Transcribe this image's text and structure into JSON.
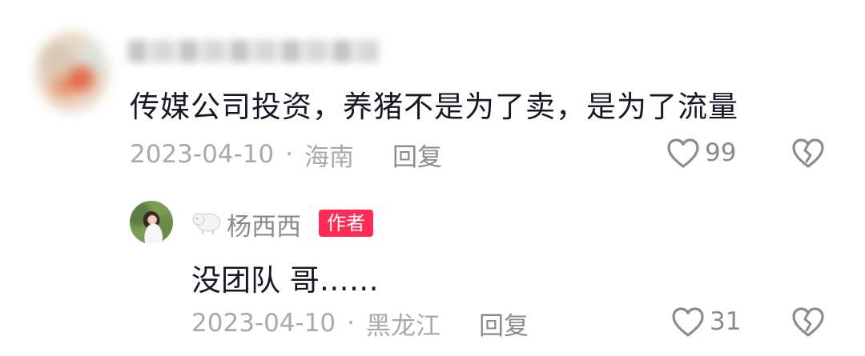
{
  "comment": {
    "text": "传媒公司投资，养猪不是为了卖，是为了流量",
    "date": "2023-04-10",
    "separator": "·",
    "location": "海南",
    "reply_label": "回复",
    "like_count": "99",
    "icons": {
      "like": "heart-outline-icon",
      "dislike": "broken-heart-icon"
    }
  },
  "reply": {
    "username": "杨西西",
    "badge": "作者",
    "text": "没团队 哥……",
    "date": "2023-04-10",
    "separator": "·",
    "location": "黑龙江",
    "reply_label": "回复",
    "like_count": "31",
    "icons": {
      "user_badge": "sheep-icon",
      "like": "heart-outline-icon",
      "dislike": "broken-heart-icon"
    }
  },
  "colors": {
    "text": "#161823",
    "secondary": "#8a8b91",
    "author_badge": "#fe2c55"
  }
}
